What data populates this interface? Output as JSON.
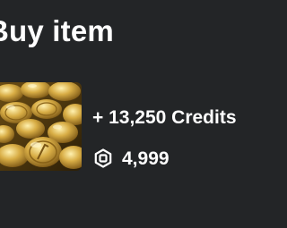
{
  "dialog": {
    "title": "Buy item"
  },
  "item": {
    "name": "+ 13,250 Credits",
    "thumbnail_icon": "gold-coins-pile-image",
    "price": {
      "currency_icon": "robux-icon",
      "value": "4,999"
    }
  },
  "colors": {
    "background": "#232527",
    "text": "#ffffff",
    "icon": "#ffffff",
    "coin_gold": "#d4a93a"
  }
}
